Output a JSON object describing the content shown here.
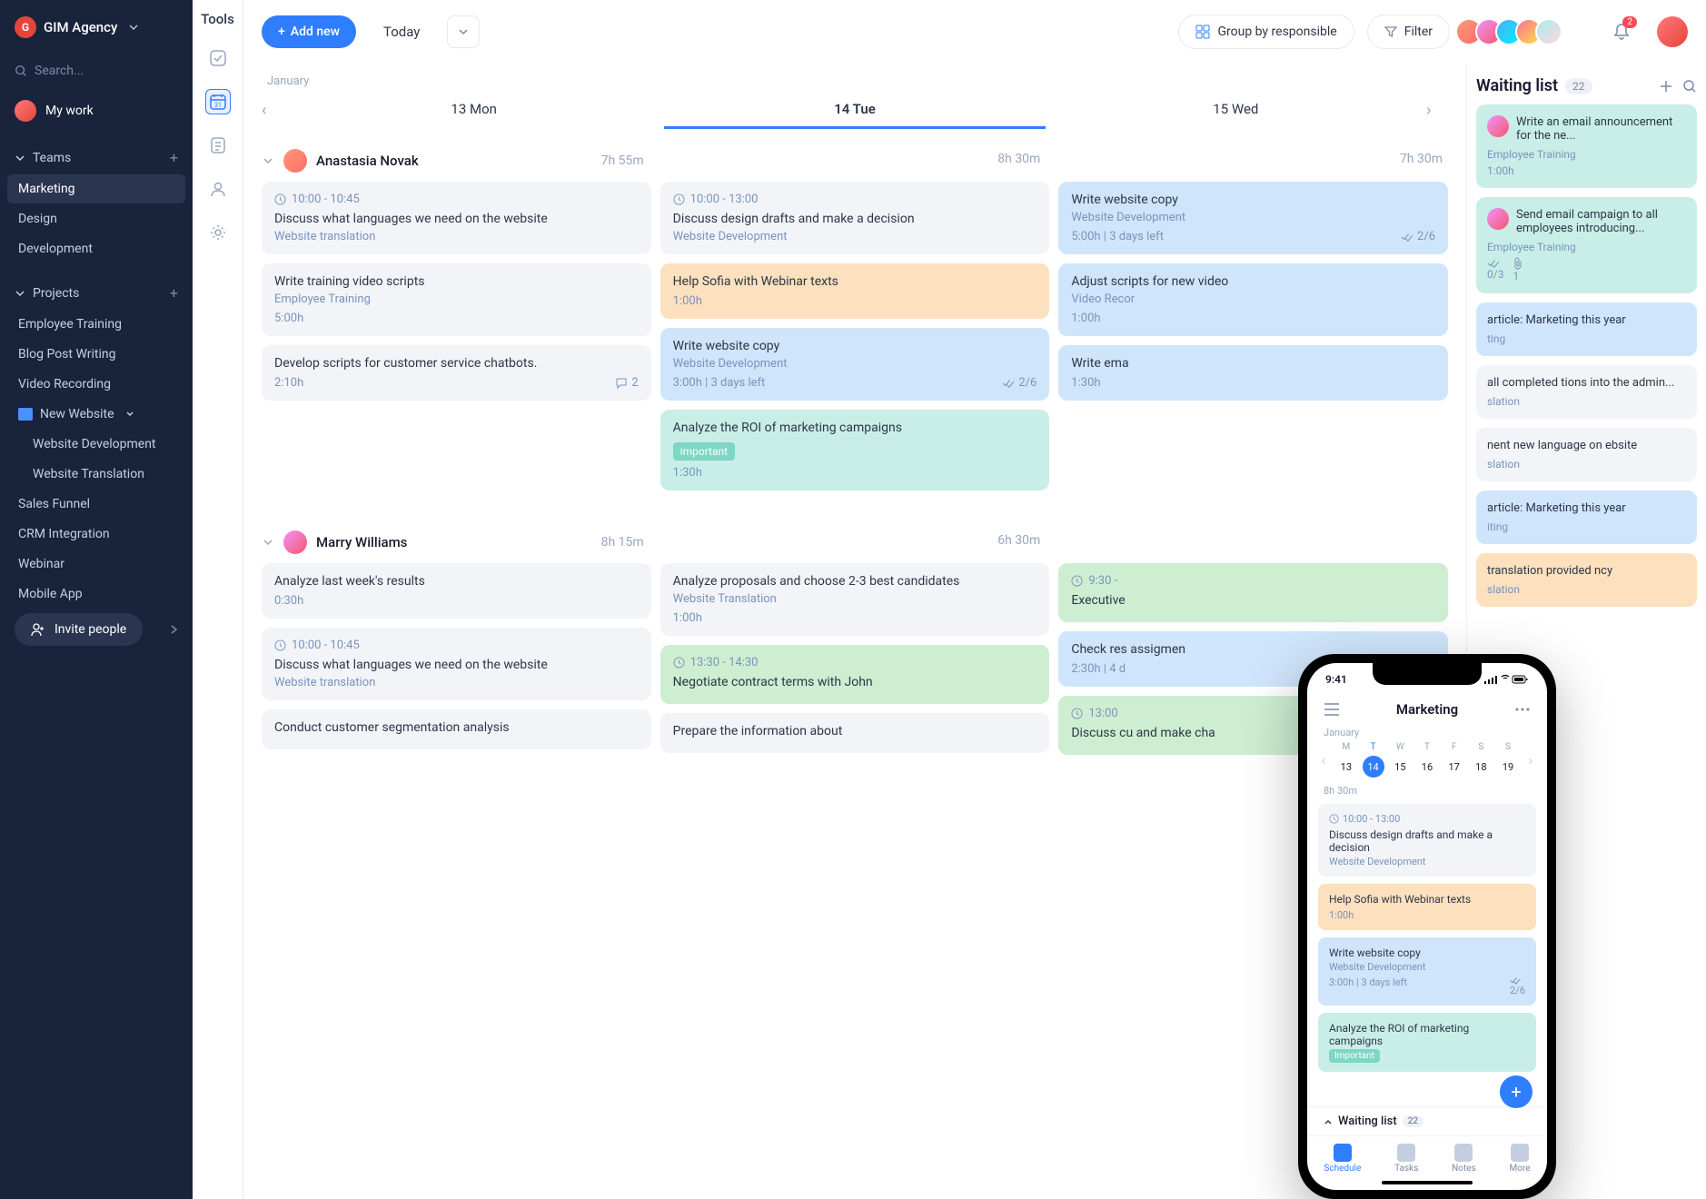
{
  "sidebar": {
    "agency": "GIM Agency",
    "search_placeholder": "Search...",
    "mywork": "My work",
    "teams_label": "Teams",
    "teams": [
      "Marketing",
      "Design",
      "Development"
    ],
    "projects_label": "Projects",
    "projects_flat": [
      "Employee Training",
      "Blog Post Writing",
      "Video Recording"
    ],
    "folder": {
      "name": "New Website",
      "children": [
        "Website Development",
        "Website Translation"
      ]
    },
    "projects_rest": [
      "Sales Funnel",
      "CRM Integration",
      "Webinar",
      "Mobile App"
    ],
    "invite": "Invite people"
  },
  "rail": {
    "label": "Tools"
  },
  "topbar": {
    "add": "Add new",
    "today": "Today",
    "group": "Group by responsible",
    "filter": "Filter",
    "notif_badge": "2"
  },
  "schedule": {
    "month": "January",
    "days": [
      "13 Mon",
      "14 Tue",
      "15 Wed"
    ],
    "people": [
      {
        "name": "Anastasia Novak",
        "headtime": "7h 55m",
        "col_times": [
          "",
          "8h 30m",
          "7h 30m"
        ],
        "cols": [
          [
            {
              "cls": "c-grey",
              "clock": "10:00 - 10:45",
              "title": "Discuss what languages we need on the website",
              "sub": "Website translation"
            },
            {
              "cls": "c-grey",
              "title": "Write training video scripts",
              "sub": "Employee Training",
              "time": "5:00h"
            },
            {
              "cls": "c-grey",
              "title": "Develop scripts for customer service chatbots.",
              "time": "2:10h",
              "comments": "2"
            }
          ],
          [
            {
              "cls": "c-grey",
              "clock": "10:00 - 13:00",
              "title": "Discuss design drafts and make a decision",
              "sub": "Website Development"
            },
            {
              "cls": "c-orange",
              "title": "Help Sofia with Webinar texts",
              "time": "1:00h"
            },
            {
              "cls": "c-blue",
              "title": "Write website copy",
              "sub": "Website Development",
              "foot_left": "3:00h | 3 days left",
              "foot_right": "2/6"
            },
            {
              "cls": "c-teal",
              "title": "Analyze the ROI of marketing campaigns",
              "tag": "important",
              "time": "1:30h"
            }
          ],
          [
            {
              "cls": "c-blue",
              "title": "Write website copy",
              "sub": "Website Development",
              "foot_left": "5:00h | 3 days left",
              "foot_right": "2/6"
            },
            {
              "cls": "c-blue",
              "title": "Adjust scripts for new video",
              "sub": "Video Recor",
              "time": "1:00h"
            },
            {
              "cls": "c-blue",
              "title": "Write ema",
              "time": "1:30h"
            }
          ]
        ]
      },
      {
        "name": "Marry Williams",
        "headtime": "8h 15m",
        "col_times": [
          "",
          "6h 30m",
          ""
        ],
        "cols": [
          [
            {
              "cls": "c-grey",
              "title": "Analyze last week's results",
              "time": "0:30h"
            },
            {
              "cls": "c-grey",
              "clock": "10:00 - 10:45",
              "title": "Discuss what languages we need on the website",
              "sub": "Website translation"
            },
            {
              "cls": "c-grey",
              "title": "Conduct customer segmentation analysis"
            }
          ],
          [
            {
              "cls": "c-grey",
              "title": "Analyze proposals and choose 2-3 best candidates",
              "sub": "Website Translation",
              "time": "1:00h"
            },
            {
              "cls": "c-green",
              "clock": "13:30 - 14:30",
              "title": "Negotiate contract terms with John"
            },
            {
              "cls": "c-grey",
              "title": "Prepare the information about"
            }
          ],
          [
            {
              "cls": "c-green",
              "clock": "9:30 -",
              "title": "Executive"
            },
            {
              "cls": "c-blue",
              "title": "Check res assigmen",
              "foot_left": "2:30h | 4 d"
            },
            {
              "cls": "c-green",
              "clock": "13:00",
              "title": "Discuss cu and make cha"
            }
          ]
        ]
      }
    ]
  },
  "waiting": {
    "title": "Waiting list",
    "count": "22",
    "items": [
      {
        "cls": "w-teal",
        "avatar": true,
        "title": "Write an email announcement for the ne...",
        "sub": "Employee Training",
        "time": "1:00h"
      },
      {
        "cls": "w-teal",
        "avatar": true,
        "title": "Send email campaign to all employees introducing...",
        "sub": "Employee Training",
        "foot": {
          "chk": "0/3",
          "att": "1"
        }
      },
      {
        "cls": "w-blue",
        "title": "article: Marketing this year",
        "sub": "ting"
      },
      {
        "cls": "w-grey",
        "title": "all completed tions into the admin...",
        "sub": "slation"
      },
      {
        "cls": "w-grey",
        "title": "nent new language on ebsite",
        "sub": "slation"
      },
      {
        "cls": "w-blue",
        "title": "article: Marketing this year",
        "sub": "iting"
      },
      {
        "cls": "w-orange",
        "title": "translation provided ncy",
        "sub": "slation"
      }
    ]
  },
  "phone": {
    "time": "9:41",
    "title": "Marketing",
    "month": "January",
    "days": [
      {
        "dw": "M",
        "dn": "13"
      },
      {
        "dw": "T",
        "dn": "14",
        "active": true
      },
      {
        "dw": "W",
        "dn": "15"
      },
      {
        "dw": "T",
        "dn": "16"
      },
      {
        "dw": "F",
        "dn": "17"
      },
      {
        "dw": "S",
        "dn": "18"
      },
      {
        "dw": "S",
        "dn": "19"
      }
    ],
    "total": "8h 30m",
    "tasks": [
      {
        "cls": "c-grey",
        "clock": "10:00 - 13:00",
        "title": "Discuss design drafts and make a decision",
        "sub": "Website Development"
      },
      {
        "cls": "c-orange",
        "title": "Help Sofia with Webinar texts",
        "time": "1:00h"
      },
      {
        "cls": "c-blue",
        "title": "Write website copy",
        "sub": "Website Development",
        "foot_left": "3:00h | 3 days left",
        "foot_right": "2/6"
      },
      {
        "cls": "c-teal",
        "title": "Analyze the ROI of marketing campaigns",
        "tag": "Important"
      }
    ],
    "waiting_label": "Waiting list",
    "waiting_count": "22",
    "tabs": [
      "Schedule",
      "Tasks",
      "Notes",
      "More"
    ]
  }
}
